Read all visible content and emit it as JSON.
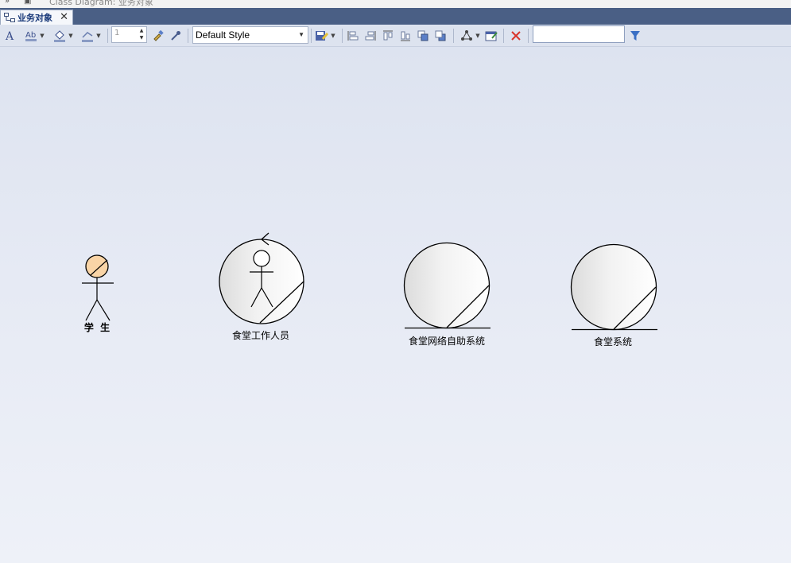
{
  "window": {
    "title": "Class Diagram: 业务对象"
  },
  "tab": {
    "label": "业务对象",
    "close": "✕"
  },
  "toolbar": {
    "line_width_value": "1",
    "style_value": "Default Style",
    "search_value": ""
  },
  "diagram": {
    "nodes": [
      {
        "kind": "actor",
        "label": "学 生"
      },
      {
        "kind": "business-worker",
        "label": "食堂工作人员"
      },
      {
        "kind": "business-entity",
        "label": "食堂网络自助系统"
      },
      {
        "kind": "business-entity",
        "label": "食堂系统"
      }
    ]
  },
  "colors": {
    "tab_bar": "#4a5f85",
    "toolbar": "#dde3ef",
    "actor_head": "#f9d4a6",
    "delete_red": "#d9342b",
    "filter_blue": "#3a6fc4"
  },
  "icons": [
    "font-icon",
    "font-color-icon",
    "fill-color-icon",
    "line-color-icon",
    "line-width-icon",
    "format-painter-icon",
    "eyedropper-icon",
    "style-save-icon",
    "align-left-icon",
    "align-right-icon",
    "align-top-icon",
    "align-bottom-icon",
    "bring-front-icon",
    "send-back-icon",
    "layout-icon",
    "properties-icon",
    "delete-icon",
    "filter-icon"
  ]
}
